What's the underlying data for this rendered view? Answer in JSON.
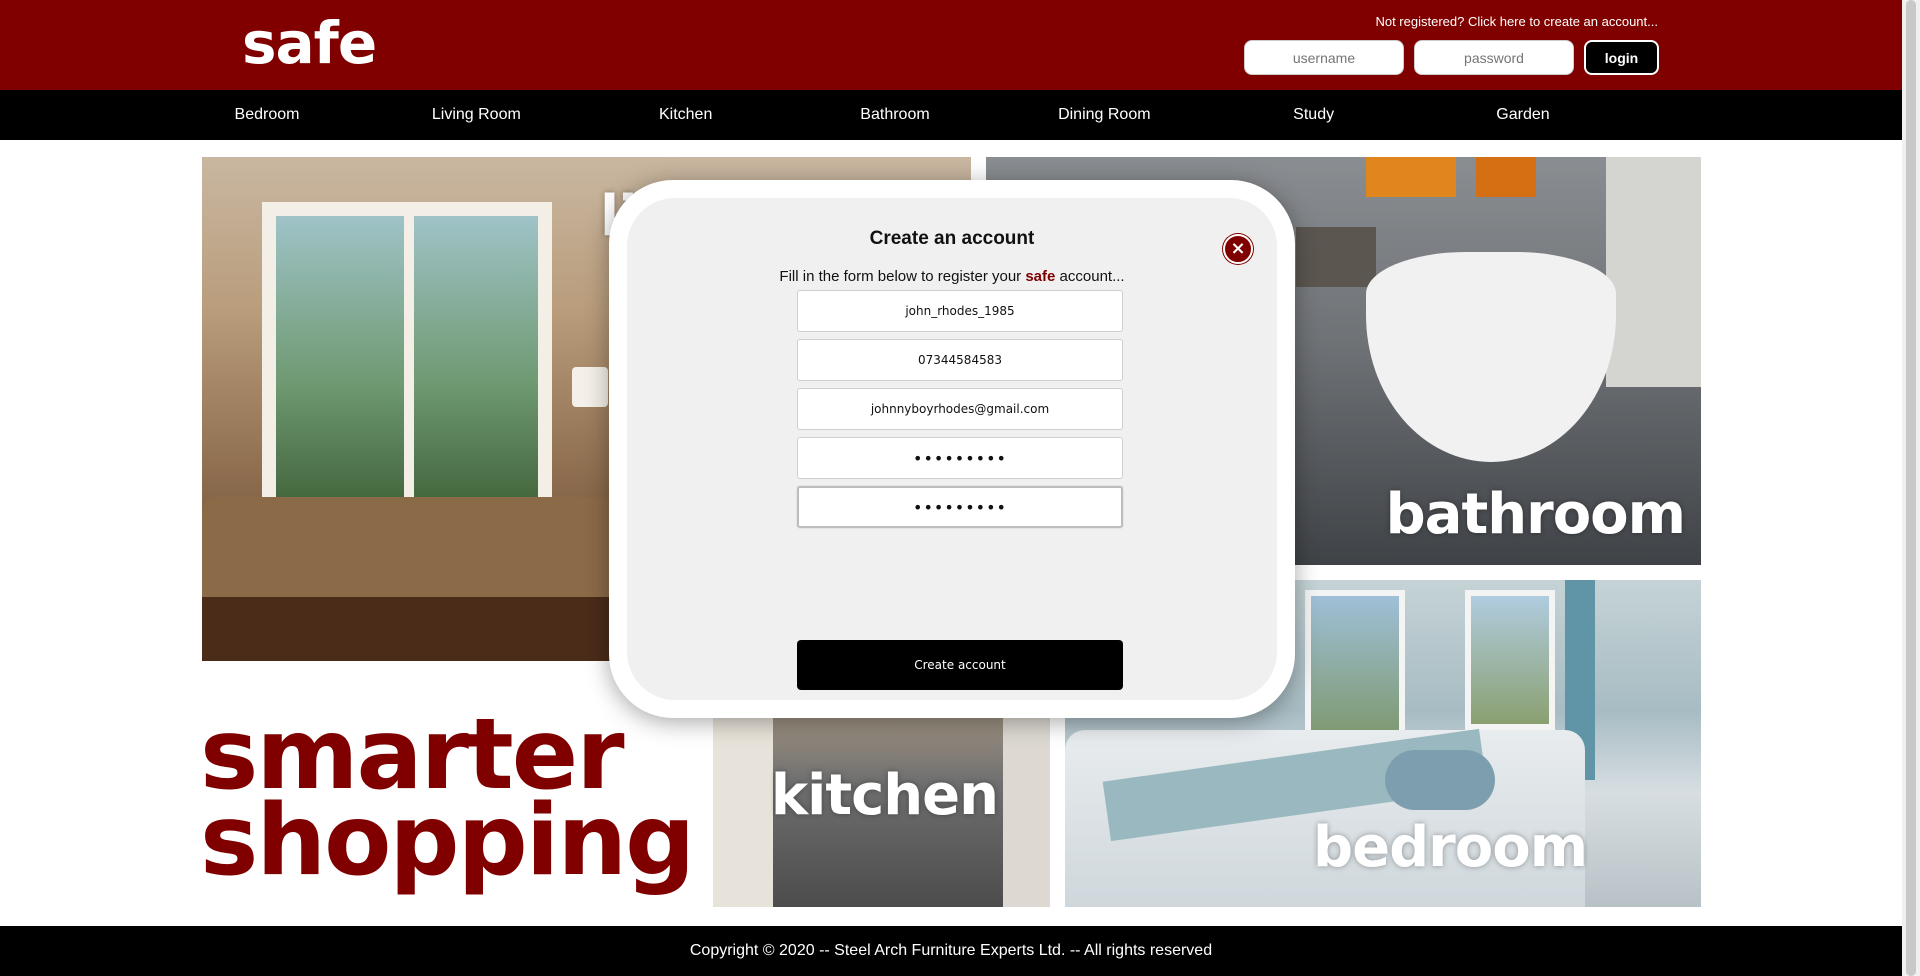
{
  "header": {
    "logo": "safe",
    "register_link": "Not registered? Click here to create an account...",
    "username_placeholder": "username",
    "password_placeholder": "password",
    "login_label": "login"
  },
  "nav": {
    "items": [
      {
        "label": "Bedroom"
      },
      {
        "label": "Living Room"
      },
      {
        "label": "Kitchen"
      },
      {
        "label": "Bathroom"
      },
      {
        "label": "Dining Room"
      },
      {
        "label": "Study"
      },
      {
        "label": "Garden"
      }
    ]
  },
  "tiles": {
    "living": "li",
    "bathroom": "bathroom",
    "kitchen": "kitchen",
    "bedroom": "bedroom"
  },
  "tagline": {
    "line1": "smarter",
    "line2": "shopping"
  },
  "modal": {
    "title": "Create an account",
    "subtitle_prefix": "Fill in the form below to register your ",
    "subtitle_brand": "safe",
    "subtitle_suffix": " account...",
    "close_icon": "×",
    "fields": {
      "username": "john_rhodes_1985",
      "phone": "07344584583",
      "email": "johnnyboyrhodes@gmail.com",
      "password": "•••••••••",
      "confirm_password": "•••••••••"
    },
    "submit_label": "Create account"
  },
  "footer": {
    "copyright": "Copyright © 2020 -- Steel Arch Furniture Experts Ltd. -- All rights reserved"
  },
  "colors": {
    "brand": "#800000",
    "nav_bg": "#000000",
    "modal_bg": "#f0f0f0"
  }
}
